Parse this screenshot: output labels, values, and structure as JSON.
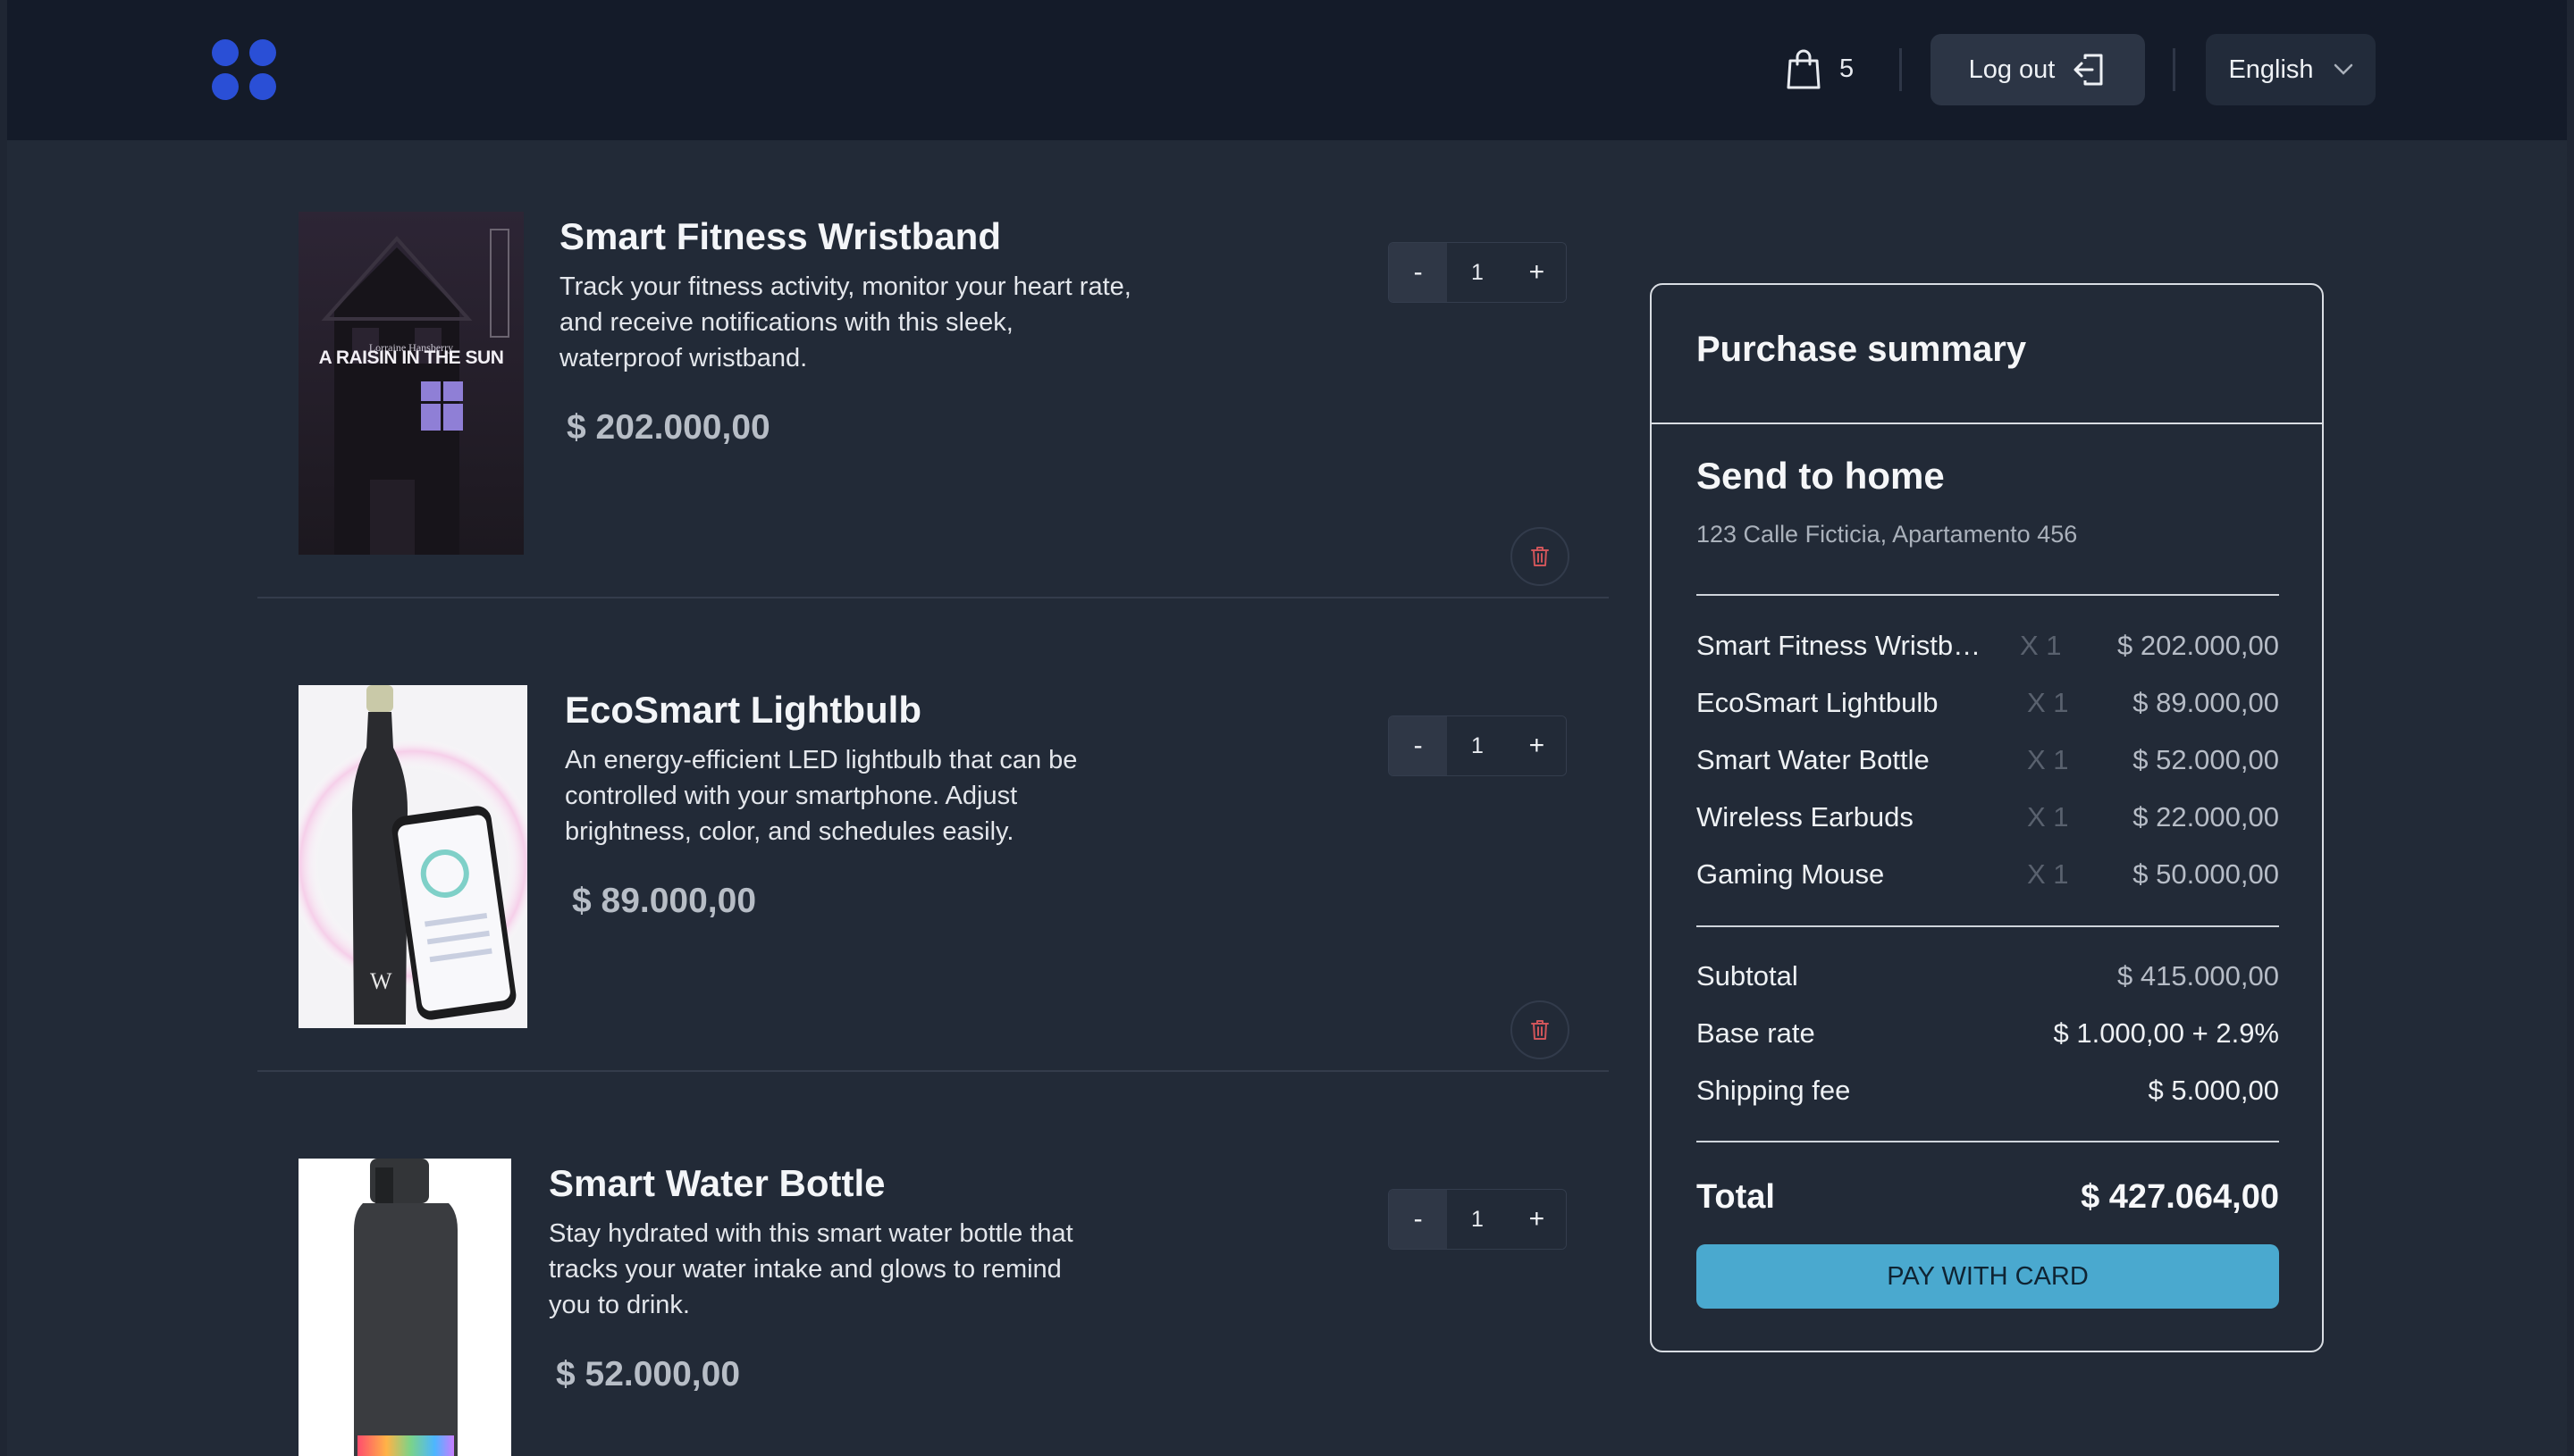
{
  "header": {
    "cart_count": "5",
    "logout_label": "Log out",
    "language": "English"
  },
  "cart": {
    "items": [
      {
        "title": "Smart Fitness Wristband",
        "description": "Track your fitness activity, monitor your heart rate, and receive notifications with this sleek, waterproof wristband.",
        "price": "$ 202.000,00",
        "quantity": "1",
        "image": {
          "author": "Lorraine Hansberry",
          "title": "A RAISIN IN THE SUN"
        }
      },
      {
        "title": "EcoSmart Lightbulb",
        "description": "An energy-efficient LED lightbulb that can be controlled with your smartphone. Adjust brightness, color, and schedules easily.",
        "price": "$ 89.000,00",
        "quantity": "1"
      },
      {
        "title": "Smart Water Bottle",
        "description": "Stay hydrated with this smart water bottle that tracks your water intake and glows to remind you to drink.",
        "price": "$ 52.000,00",
        "quantity": "1"
      }
    ],
    "decrement_label": "-",
    "increment_label": "+"
  },
  "summary": {
    "title": "Purchase summary",
    "delivery_title": "Send to home",
    "address": "123 Calle Ficticia, Apartamento 456",
    "lines": [
      {
        "name": "Smart Fitness Wristband",
        "qty": "X 1",
        "price": "$ 202.000,00"
      },
      {
        "name": "EcoSmart Lightbulb",
        "qty": "X 1",
        "price": "$ 89.000,00"
      },
      {
        "name": "Smart Water Bottle",
        "qty": "X 1",
        "price": "$ 52.000,00"
      },
      {
        "name": "Wireless Earbuds",
        "qty": "X 1",
        "price": "$ 22.000,00"
      },
      {
        "name": "Gaming Mouse",
        "qty": "X 1",
        "price": "$ 50.000,00"
      }
    ],
    "subtotal_label": "Subtotal",
    "subtotal_value": "$ 415.000,00",
    "base_rate_label": "Base rate",
    "base_rate_value": "$ 1.000,00 + 2.9%",
    "shipping_label": "Shipping fee",
    "shipping_value": "$ 5.000,00",
    "total_label": "Total",
    "total_value": "$ 427.064,00",
    "pay_label": "PAY WITH CARD"
  },
  "colors": {
    "page_bg": "#222a37",
    "header_bg": "#141b29",
    "logo": "#2a4fd6",
    "pay_button": "#4aa9cf",
    "trash_icon": "#d0555a"
  }
}
